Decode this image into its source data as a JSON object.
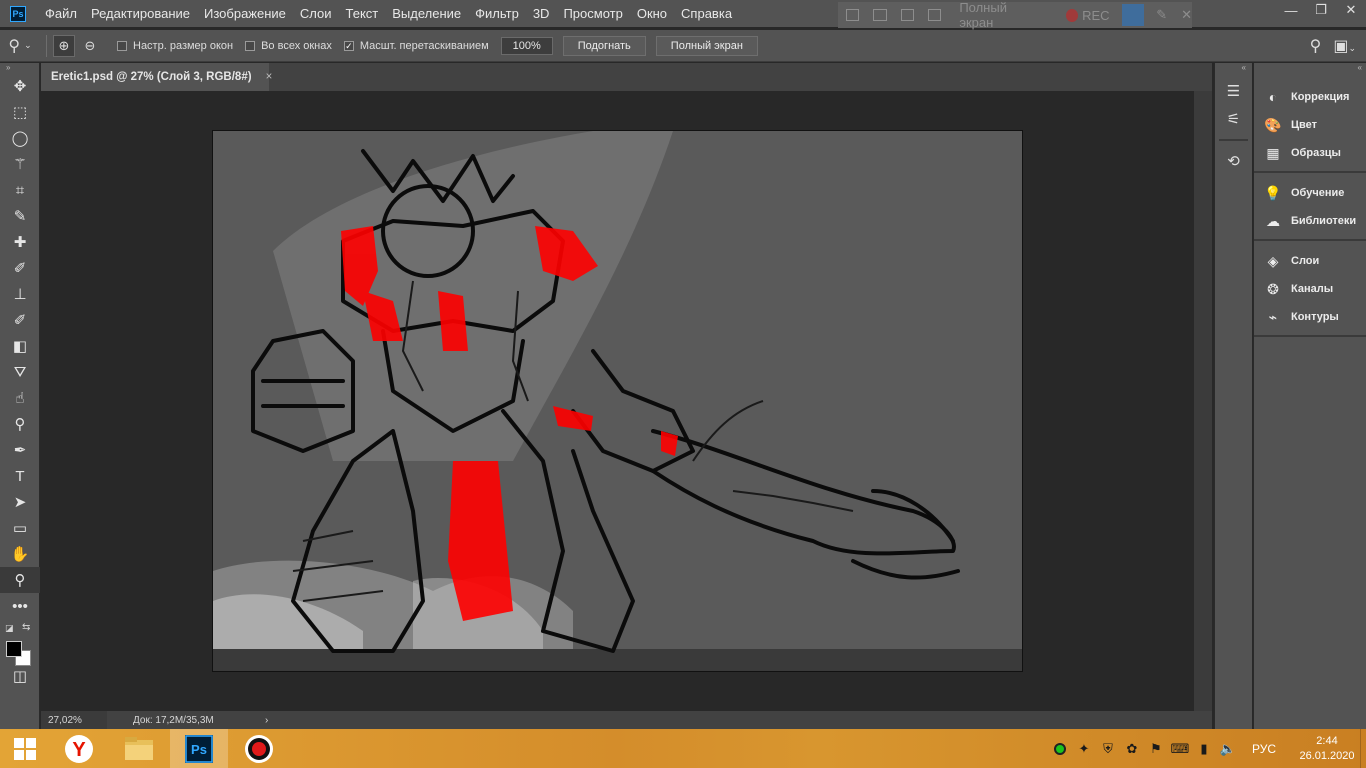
{
  "app": {
    "logo_text": "Ps",
    "menu": [
      "Файл",
      "Редактирование",
      "Изображение",
      "Слои",
      "Текст",
      "Выделение",
      "Фильтр",
      "3D",
      "Просмотр",
      "Окно",
      "Справка"
    ],
    "recorder": {
      "fullscreen_label": "Полный экран",
      "rec_label": "REC"
    },
    "window_controls": {
      "minimize": "—",
      "restore": "❐",
      "close": "✕"
    }
  },
  "options_bar": {
    "tool_icon": "zoom-tool",
    "zoom_in_icon": "⊕",
    "zoom_out_icon": "⊖",
    "resize_windows": {
      "label": "Настр. размер окон",
      "checked": false
    },
    "all_windows": {
      "label": "Во всех окнах",
      "checked": false
    },
    "scrubby_zoom": {
      "label": "Масшт. перетаскиванием",
      "checked": true
    },
    "zoom_value": "100%",
    "fit_button": "Подогнать",
    "fullscreen_button": "Полный экран"
  },
  "document": {
    "tab_title": "Eretic1.psd @ 27% (Слой 3, RGB/8#)",
    "close_icon": "×"
  },
  "status_bar": {
    "zoom": "27,02%",
    "doc_info": "Док: 17,2M/35,3M",
    "arrow": "›"
  },
  "tools": [
    "move-tool",
    "marquee-tool",
    "lasso-tool",
    "magic-wand-tool",
    "crop-tool",
    "eyedropper-tool",
    "healing-brush-tool",
    "brush-tool",
    "stamp-tool",
    "history-brush-tool",
    "eraser-tool",
    "paint-bucket-tool",
    "smudge-tool",
    "dodge-tool",
    "pen-tool",
    "type-tool",
    "path-selection-tool",
    "rectangle-tool",
    "hand-tool",
    "zoom-tool",
    "more-tools"
  ],
  "tool_glyphs": [
    "✥",
    "⬚",
    "◯",
    "⚚",
    "⌗",
    "✎",
    "✚",
    "✐",
    "⊥",
    "✐",
    "◧",
    "⛛",
    "☝",
    "⚲",
    "✒",
    "T",
    "➤",
    "▭",
    "✋",
    "⚲",
    "•••"
  ],
  "colors": {
    "foreground": "#000000",
    "background": "#ffffff",
    "accent_red": "#ff0000"
  },
  "panels": {
    "group1": [
      {
        "label": "Коррекция",
        "icon": "adjustments-icon",
        "glyph": "◐"
      },
      {
        "label": "Цвет",
        "icon": "color-palette-icon",
        "glyph": "🎨"
      },
      {
        "label": "Образцы",
        "icon": "swatches-grid-icon",
        "glyph": "▦"
      }
    ],
    "group2": [
      {
        "label": "Обучение",
        "icon": "lightbulb-icon",
        "glyph": "💡"
      },
      {
        "label": "Библиотеки",
        "icon": "cloud-libraries-icon",
        "glyph": "☁"
      }
    ],
    "group3": [
      {
        "label": "Слои",
        "icon": "layers-icon",
        "glyph": "◈"
      },
      {
        "label": "Каналы",
        "icon": "channels-icon",
        "glyph": "❂"
      },
      {
        "label": "Контуры",
        "icon": "paths-icon",
        "glyph": "⌁"
      }
    ]
  },
  "taskbar": {
    "apps": [
      "yandex-browser",
      "file-explorer",
      "photoshop",
      "screen-recorder"
    ],
    "language": "РУС",
    "time": "2:44",
    "date": "26.01.2020"
  }
}
